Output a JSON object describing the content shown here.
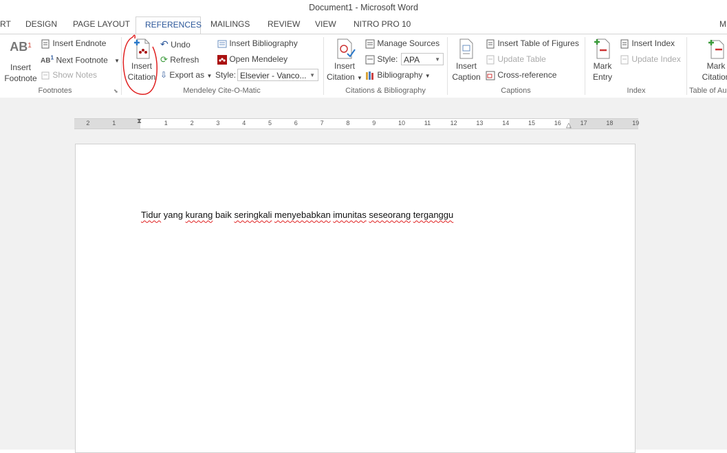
{
  "window": {
    "title": "Document1 - Microsoft Word"
  },
  "tabs": [
    "RT",
    "DESIGN",
    "PAGE LAYOUT",
    "REFERENCES",
    "MAILINGS",
    "REVIEW",
    "VIEW",
    "NITRO PRO 10",
    "M"
  ],
  "active_tab": "REFERENCES",
  "ribbon": {
    "footnotes": {
      "group_label": "Footnotes",
      "insert_footnote": [
        "Insert",
        "Footnote"
      ],
      "insert_endnote": "Insert Endnote",
      "next_footnote": "Next Footnote",
      "show_notes": "Show Notes"
    },
    "mendeley": {
      "group_label": "Mendeley Cite-O-Matic",
      "insert_citation": [
        "Insert",
        "Citation"
      ],
      "undo": "Undo",
      "refresh": "Refresh",
      "export_as": "Export as",
      "insert_bibliography": "Insert Bibliography",
      "open_mendeley": "Open Mendeley",
      "style_label": "Style:",
      "style_value": "Elsevier - Vanco..."
    },
    "citations": {
      "group_label": "Citations & Bibliography",
      "insert_citation": [
        "Insert",
        "Citation"
      ],
      "manage_sources": "Manage Sources",
      "style_label": "Style:",
      "style_value": "APA",
      "bibliography": "Bibliography"
    },
    "captions": {
      "group_label": "Captions",
      "insert_caption": [
        "Insert",
        "Caption"
      ],
      "insert_table_of_figures": "Insert Table of Figures",
      "update_table": "Update Table",
      "cross_reference": "Cross-reference"
    },
    "index": {
      "group_label": "Index",
      "mark_entry": [
        "Mark",
        "Entry"
      ],
      "insert_index": "Insert Index",
      "update_index": "Update Index"
    },
    "toa": {
      "group_label": "Table of Au",
      "mark_citation": [
        "Mark",
        "Citation"
      ]
    }
  },
  "ruler": {
    "ticks": [
      "2",
      "1",
      "1",
      "2",
      "3",
      "4",
      "5",
      "6",
      "7",
      "8",
      "9",
      "10",
      "11",
      "12",
      "13",
      "14",
      "15",
      "16",
      "17",
      "18",
      "19"
    ]
  },
  "document": {
    "words": [
      "Tidur",
      "yang",
      "kurang",
      "baik",
      "seringkali",
      "menyebabkan",
      "imunitas",
      "seseorang",
      "terganggu"
    ],
    "squiggly": [
      true,
      false,
      true,
      false,
      true,
      true,
      true,
      true,
      true
    ]
  },
  "colors": {
    "accent": "#2b579a",
    "annotation": "#e02020"
  }
}
